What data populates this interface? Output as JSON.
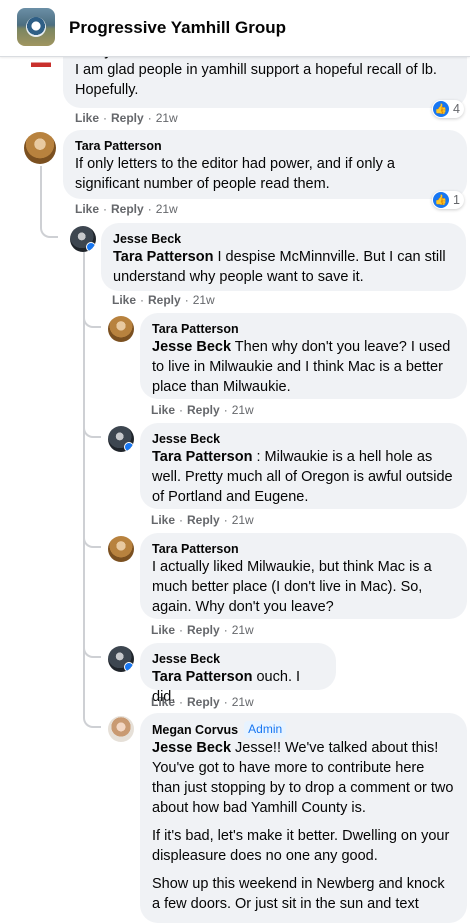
{
  "header": {
    "title": "Progressive Yamhill Group"
  },
  "actions": {
    "like": "Like",
    "reply": "Reply",
    "sep": "·"
  },
  "comments": [
    {
      "id": "c0",
      "author": "Jenny Wilson",
      "text": "I am glad people in yamhill support a hopeful recall of lb. Hopefully.",
      "time": "21w",
      "reactions": "4"
    },
    {
      "id": "c1",
      "author": "Tara Patterson",
      "text": "If only letters to the editor had power, and if only a significant number of people read them.",
      "time": "21w",
      "reactions": "1"
    },
    {
      "id": "c2",
      "author": "Jesse Beck",
      "tag": "Tara Patterson",
      "text": " I despise McMinnville. But I can still understand why people want to save it.",
      "time": "21w"
    },
    {
      "id": "c3",
      "author": "Tara Patterson",
      "tag": "Jesse Beck",
      "text": " Then why don't you leave? I used to live in Milwaukie and I think Mac is a better place than Milwaukie.",
      "time": "21w"
    },
    {
      "id": "c4",
      "author": "Jesse Beck",
      "tag": "Tara Patterson",
      "text": " : Milwaukie is a hell hole as well. Pretty much all of Oregon is awful outside of Portland and Eugene.",
      "time": "21w"
    },
    {
      "id": "c5",
      "author": "Tara Patterson",
      "text": "I actually liked Milwaukie, but think Mac is a much better place (I don't live in Mac). So, again. Why don't you leave?",
      "time": "21w"
    },
    {
      "id": "c6",
      "author": "Jesse Beck",
      "tag": "Tara Patterson",
      "text": " ouch. I did.",
      "time": "21w"
    },
    {
      "id": "c7",
      "author": "Megan Corvus",
      "badge": "Admin",
      "tag": "Jesse Beck",
      "text": " Jesse!! We've talked about this! You've got to have more to contribute here than just stopping by to drop a comment or two about how bad Yamhill County is.",
      "p2": "If it's bad, let's make it better. Dwelling on your displeasure does no one any good.",
      "p3": "Show up this weekend in Newberg and knock a few doors. Or just sit in the sun and text"
    }
  ],
  "colors": {
    "accent": "#1877f2",
    "bubble": "#f0f2f5",
    "meta": "#65676b"
  }
}
